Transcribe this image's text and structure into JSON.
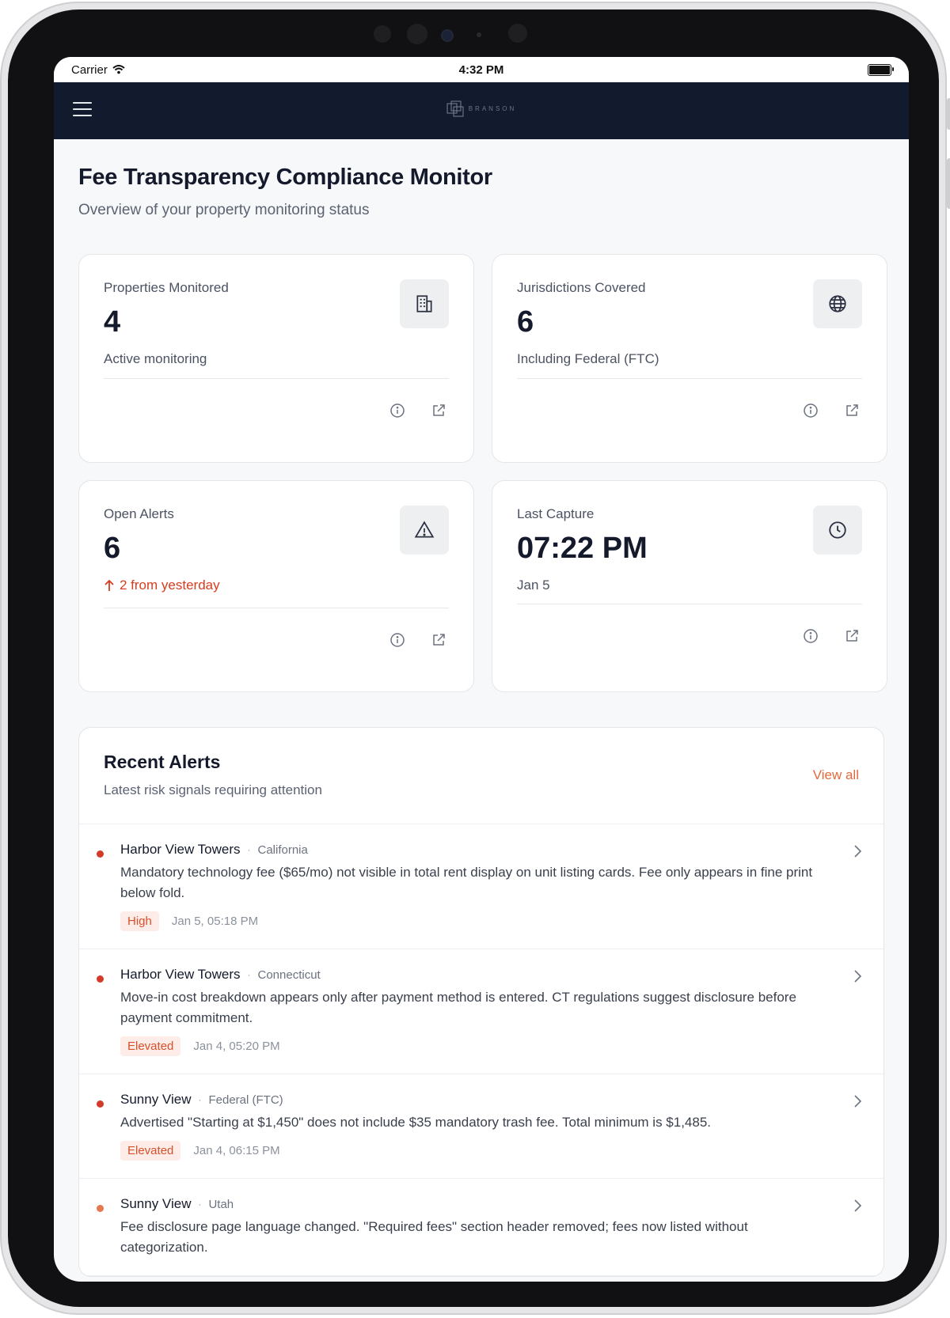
{
  "status_bar": {
    "carrier": "Carrier",
    "time": "4:32 PM"
  },
  "navbar": {
    "logo_text": "BRANSON"
  },
  "page": {
    "title": "Fee Transparency Compliance Monitor",
    "subtitle": "Overview of your property monitoring status"
  },
  "cards": [
    {
      "label": "Properties Monitored",
      "value": "4",
      "note": "Active monitoring",
      "icon": "building-icon"
    },
    {
      "label": "Jurisdictions Covered",
      "value": "6",
      "note": "Including Federal (FTC)",
      "icon": "globe-icon"
    },
    {
      "label": "Open Alerts",
      "value": "6",
      "note": "2 from yesterday",
      "icon": "warning-icon",
      "note_color": "#d63d1f"
    },
    {
      "label": "Last Capture",
      "value": "07:22 PM",
      "note": "Jan 5",
      "icon": "clock-icon"
    }
  ],
  "alerts_section": {
    "title": "Recent Alerts",
    "subtitle": "Latest risk signals requiring attention",
    "view_all": "View all",
    "items": [
      {
        "property": "Harbor View Towers",
        "jurisdiction": "California",
        "description": "Mandatory technology fee ($65/mo) not visible in total rent display on unit listing cards. Fee only appears in fine print below fold.",
        "severity": "High",
        "date": "Jan 5, 05:18 PM",
        "dot_color": "#d43a2a"
      },
      {
        "property": "Harbor View Towers",
        "jurisdiction": "Connecticut",
        "description": "Move-in cost breakdown appears only after payment method is entered. CT regulations suggest disclosure before payment commitment.",
        "severity": "Elevated",
        "date": "Jan 4, 05:20 PM",
        "dot_color": "#d43a2a"
      },
      {
        "property": "Sunny View",
        "jurisdiction": "Federal (FTC)",
        "description": "Advertised \"Starting at $1,450\" does not include $35 mandatory trash fee. Total minimum is $1,485.",
        "severity": "Elevated",
        "date": "Jan 4, 06:15 PM",
        "dot_color": "#d43a2a"
      },
      {
        "property": "Sunny View",
        "jurisdiction": "Utah",
        "description": "Fee disclosure page language changed. \"Required fees\" section header removed; fees now listed without categorization.",
        "severity": "",
        "date": "",
        "dot_color": "#e67850"
      }
    ]
  },
  "colors": {
    "navbar": "#121a2e",
    "accent": "#e16a3d",
    "alert_red": "#d63d1f"
  }
}
